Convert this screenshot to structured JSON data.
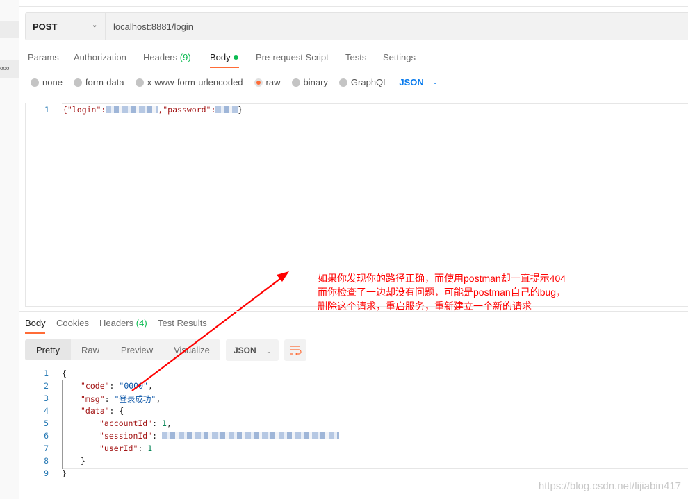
{
  "request": {
    "method": "POST",
    "url": "localhost:8881/login",
    "tabs": [
      {
        "label": "Params"
      },
      {
        "label": "Authorization"
      },
      {
        "label": "Headers",
        "count": "(9)"
      },
      {
        "label": "Body"
      },
      {
        "label": "Pre-request Script"
      },
      {
        "label": "Tests"
      },
      {
        "label": "Settings"
      }
    ],
    "active_tab": "Body",
    "body_types": [
      "none",
      "form-data",
      "x-www-form-urlencoded",
      "raw",
      "binary",
      "GraphQL"
    ],
    "selected_body_type": "raw",
    "format": "JSON",
    "editor": {
      "line_number": "1",
      "part1": "{\"login\":",
      "part2": ",\"password\":",
      "part3": "}"
    }
  },
  "response": {
    "tabs": [
      {
        "label": "Body"
      },
      {
        "label": "Cookies"
      },
      {
        "label": "Headers",
        "count": "(4)"
      },
      {
        "label": "Test Results"
      }
    ],
    "views": [
      "Pretty",
      "Raw",
      "Preview",
      "Visualize"
    ],
    "active_view": "Pretty",
    "format": "JSON",
    "lines": [
      {
        "n": "1",
        "text": "{"
      },
      {
        "n": "2",
        "key": "\"code\"",
        "sep": ": ",
        "value": "\"0000\"",
        "tail": ","
      },
      {
        "n": "3",
        "key": "\"msg\"",
        "sep": ": ",
        "value": "\"登录成功\"",
        "tail": ","
      },
      {
        "n": "4",
        "key": "\"data\"",
        "sep": ": ",
        "tail": "{"
      },
      {
        "n": "5",
        "key": "\"accountId\"",
        "sep": ": ",
        "num": "1",
        "tail": ","
      },
      {
        "n": "6",
        "key": "\"sessionId\"",
        "sep": ": "
      },
      {
        "n": "7",
        "key": "\"userId\"",
        "sep": ": ",
        "num": "1"
      },
      {
        "n": "8",
        "text": "}"
      },
      {
        "n": "9",
        "text": "}"
      }
    ]
  },
  "annotation": {
    "lines": [
      "如果你发现你的路径正确，而使用postman却一直提示404",
      "而你检查了一边却没有问题，可能是postman自己的bug，",
      "删除这个请求，重启服务，重新建立一个新的请求"
    ],
    "color": "#ff0000"
  },
  "watermark": "https://blog.csdn.net/lijiabin417",
  "colors": {
    "accent": "#ff6c37",
    "green": "#0cbb52",
    "link": "#097bed"
  }
}
